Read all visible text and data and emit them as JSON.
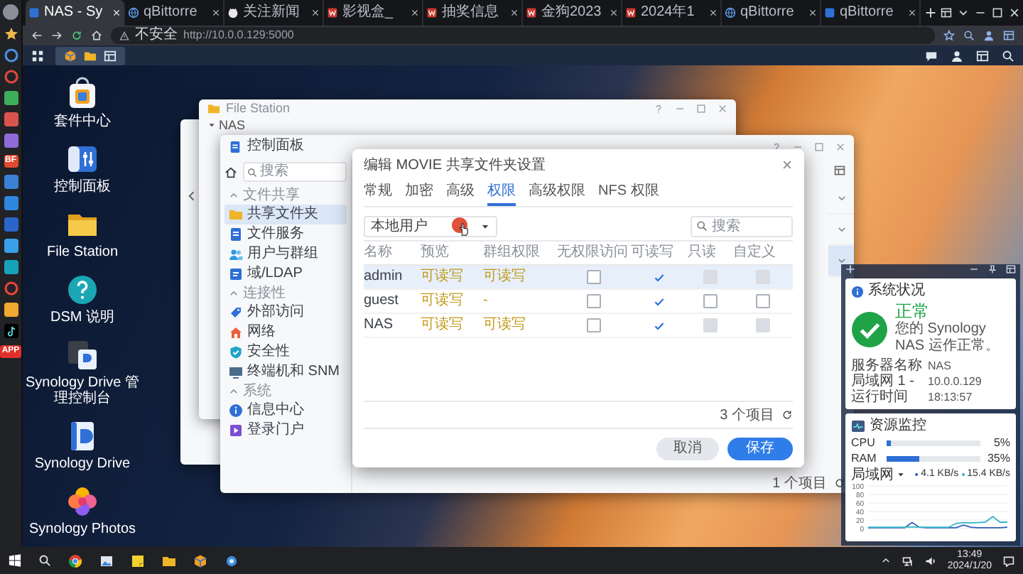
{
  "browser": {
    "side_icons": [
      {
        "kind": "avatar",
        "color": "#8a8f98"
      },
      {
        "kind": "star",
        "color": "#f2b84b"
      },
      {
        "kind": "ring",
        "color": "#4a8fe0"
      },
      {
        "kind": "ring",
        "color": "#e0483c"
      },
      {
        "kind": "tile",
        "color": "#3fae5a"
      },
      {
        "kind": "tile",
        "color": "#d9534f"
      },
      {
        "kind": "tile",
        "color": "#8e6bd8"
      },
      {
        "kind": "label",
        "color": "#e04a2f",
        "text": "BF"
      },
      {
        "kind": "tile",
        "color": "#3b82d6"
      },
      {
        "kind": "tile",
        "color": "#2f86e0"
      },
      {
        "kind": "tile",
        "color": "#2a66c8"
      },
      {
        "kind": "tile",
        "color": "#3aa0e8"
      },
      {
        "kind": "tile",
        "color": "#16a3b8"
      },
      {
        "kind": "ring",
        "color": "#e8453c"
      },
      {
        "kind": "tile",
        "color": "#f0a830"
      },
      {
        "kind": "note",
        "color": "#000000"
      },
      {
        "kind": "label",
        "color": "#e0302a",
        "text": "APP"
      }
    ],
    "tabs": [
      {
        "kind": "nas",
        "title": "NAS - Sy",
        "selected": true
      },
      {
        "kind": "globe",
        "title": "qBittorre",
        "selected": false
      },
      {
        "kind": "cat",
        "title": "关注新闻",
        "selected": false
      },
      {
        "kind": "w",
        "title": "影视盒_",
        "selected": false
      },
      {
        "kind": "w",
        "title": "抽奖信息",
        "selected": false
      },
      {
        "kind": "w",
        "title": "金狗2023",
        "selected": false
      },
      {
        "kind": "w",
        "title": "2024年1",
        "selected": false
      },
      {
        "kind": "globe",
        "title": "qBittorre",
        "selected": false
      },
      {
        "kind": "nas",
        "title": "qBittorre",
        "selected": false
      }
    ],
    "address": {
      "security": "不安全",
      "url": "http://10.0.0.129:5000"
    }
  },
  "desktop_icons": [
    {
      "kind": "package",
      "label": "套件中心"
    },
    {
      "kind": "control",
      "label": "控制面板"
    },
    {
      "kind": "folder",
      "label": "File Station"
    },
    {
      "kind": "help",
      "label": "DSM 说明"
    },
    {
      "kind": "drive_admin",
      "label": "Synology Drive 管理控制台"
    },
    {
      "kind": "drive",
      "label": "Synology Drive"
    },
    {
      "kind": "photos",
      "label": "Synology Photos"
    }
  ],
  "file_station": {
    "title": "File Station",
    "tree_root": "NAS"
  },
  "control_panel": {
    "title": "控制面板",
    "search": {
      "placeholder": "搜索"
    },
    "sections": [
      {
        "heading": "文件共享",
        "expanded": true,
        "items": [
          {
            "label": "共享文件夹",
            "kind": "folder",
            "selected": true
          },
          {
            "label": "文件服务",
            "kind": "document",
            "selected": false
          },
          {
            "label": "用户与群组",
            "kind": "users",
            "selected": false
          },
          {
            "label": "域/LDAP",
            "kind": "idcard",
            "selected": false
          }
        ]
      },
      {
        "heading": "连接性",
        "expanded": true,
        "items": [
          {
            "label": "外部访问",
            "kind": "link",
            "selected": false
          },
          {
            "label": "网络",
            "kind": "house",
            "selected": false
          },
          {
            "label": "安全性",
            "kind": "shield",
            "selected": false
          },
          {
            "label": "终端机和 SNM",
            "kind": "monitor",
            "selected": false
          }
        ]
      },
      {
        "heading": "系统",
        "expanded": true,
        "items": [
          {
            "label": "信息中心",
            "kind": "info",
            "selected": false
          },
          {
            "label": "登录门户",
            "kind": "portal",
            "selected": false
          }
        ]
      }
    ],
    "rows": [
      {
        "selected": false
      },
      {
        "selected": false
      },
      {
        "selected": true
      }
    ],
    "footer": "1 个项目"
  },
  "dialog": {
    "title": "编辑 MOVIE 共享文件夹设置",
    "tabs": [
      {
        "label": "常规",
        "selected": false
      },
      {
        "label": "加密",
        "selected": false
      },
      {
        "label": "高级",
        "selected": false
      },
      {
        "label": "权限",
        "selected": true
      },
      {
        "label": "高级权限",
        "selected": false
      },
      {
        "label": "NFS 权限",
        "selected": false
      }
    ],
    "filter": {
      "value": "本地用户"
    },
    "search": {
      "placeholder": "搜索"
    },
    "columns": [
      "名称",
      "预览",
      "群组权限",
      "无权限访问",
      "可读写",
      "只读",
      "自定义"
    ],
    "rows": [
      {
        "name": "admin",
        "preview": "可读写",
        "group": "可读写",
        "selected": true,
        "permissions": [
          {
            "checked": false,
            "disabled": false
          },
          {
            "checked": true,
            "disabled": false
          },
          {
            "checked": false,
            "disabled": true
          },
          {
            "checked": false,
            "disabled": true
          }
        ]
      },
      {
        "name": "guest",
        "preview": "可读写",
        "group": "-",
        "selected": false,
        "permissions": [
          {
            "checked": false,
            "disabled": false
          },
          {
            "checked": true,
            "disabled": false
          },
          {
            "checked": false,
            "disabled": false
          },
          {
            "checked": false,
            "disabled": false
          }
        ]
      },
      {
        "name": "NAS",
        "preview": "可读写",
        "group": "可读写",
        "selected": false,
        "permissions": [
          {
            "checked": false,
            "disabled": false
          },
          {
            "checked": true,
            "disabled": false
          },
          {
            "checked": false,
            "disabled": true
          },
          {
            "checked": false,
            "disabled": true
          }
        ]
      }
    ],
    "footer": "3 个项目",
    "buttons": [
      {
        "label": "取消",
        "kind": "secondary"
      },
      {
        "label": "保存",
        "kind": "primary"
      }
    ]
  },
  "widget": {
    "system": {
      "title": "系统状况",
      "status": "正常",
      "message": "您的 Synology NAS 运作正常。",
      "info": [
        {
          "label": "服务器名称",
          "value": "NAS"
        },
        {
          "label": "局域网 1 -",
          "value": "10.0.0.129"
        },
        {
          "label": "运行时间",
          "value": "18:13:57"
        }
      ]
    },
    "resource": {
      "title": "资源监控",
      "meters": [
        {
          "label": "CPU",
          "level": 0.05,
          "reading": "5%"
        },
        {
          "label": "RAM",
          "level": 0.35,
          "reading": "35%"
        }
      ],
      "network": {
        "label": "局域网",
        "rates": [
          {
            "value": "4.1 KB/s",
            "color": "#2f5fb8"
          },
          {
            "value": "15.4 KB/s",
            "color": "#33b6c8"
          }
        ],
        "chart_data": {
          "type": "line",
          "grid": true,
          "ylim": [
            0,
            100
          ],
          "yticks": [
            0,
            20,
            40,
            60,
            80,
            100
          ],
          "series": [
            {
              "color": "#2f5fb8",
              "values": [
                2,
                2,
                2,
                2,
                2,
                2,
                14,
                3,
                2,
                2,
                2,
                2,
                2,
                8,
                3,
                2,
                2,
                2,
                2,
                3
              ]
            },
            {
              "color": "#33b6c8",
              "values": [
                3,
                3,
                3,
                3,
                3,
                3,
                4,
                3,
                3,
                3,
                3,
                3,
                12,
                14,
                13,
                14,
                15,
                28,
                15,
                15
              ]
            }
          ]
        }
      }
    }
  },
  "taskbar": {
    "time": "13:49",
    "date": "2024/1/20"
  }
}
